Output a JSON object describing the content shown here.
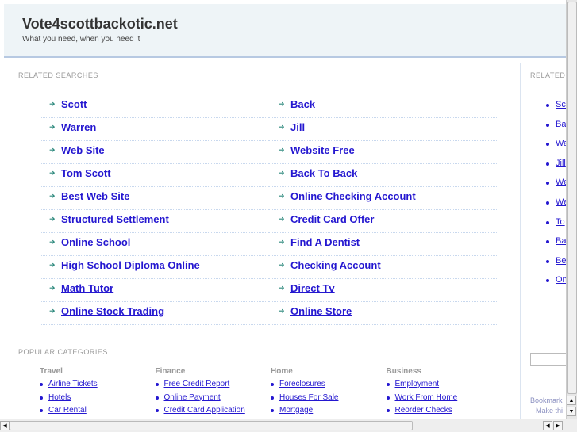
{
  "header": {
    "title": "Vote4scottbackotic.net",
    "tagline": "What you need, when you need it"
  },
  "related": {
    "heading": "RELATED SEARCHES",
    "left": [
      "Scott",
      "Warren",
      "Web Site",
      "Tom Scott",
      "Best Web Site",
      "Structured Settlement",
      "Online School",
      "High School Diploma Online",
      "Math Tutor",
      "Online Stock Trading"
    ],
    "right": [
      "Back",
      "Jill",
      "Website Free",
      "Back To Back",
      "Online Checking Account",
      "Credit Card Offer",
      "Find A Dentist",
      "Checking Account",
      "Direct Tv",
      "Online Store"
    ]
  },
  "sidebar": {
    "heading": "RELATED",
    "items": [
      "Sco",
      "Bac",
      "Wa",
      "Jill",
      "We",
      "We",
      "To",
      "Bac",
      "Bes",
      "Onl"
    ],
    "bookmark": "Bookmark",
    "make": "Make thi"
  },
  "popular": {
    "heading": "POPULAR CATEGORIES",
    "columns": [
      {
        "title": "Travel",
        "items": [
          "Airline Tickets",
          "Hotels",
          "Car Rental"
        ]
      },
      {
        "title": "Finance",
        "items": [
          "Free Credit Report",
          "Online Payment",
          "Credit Card Application"
        ]
      },
      {
        "title": "Home",
        "items": [
          "Foreclosures",
          "Houses For Sale",
          "Mortgage"
        ]
      },
      {
        "title": "Business",
        "items": [
          "Employment",
          "Work From Home",
          "Reorder Checks"
        ]
      }
    ]
  }
}
